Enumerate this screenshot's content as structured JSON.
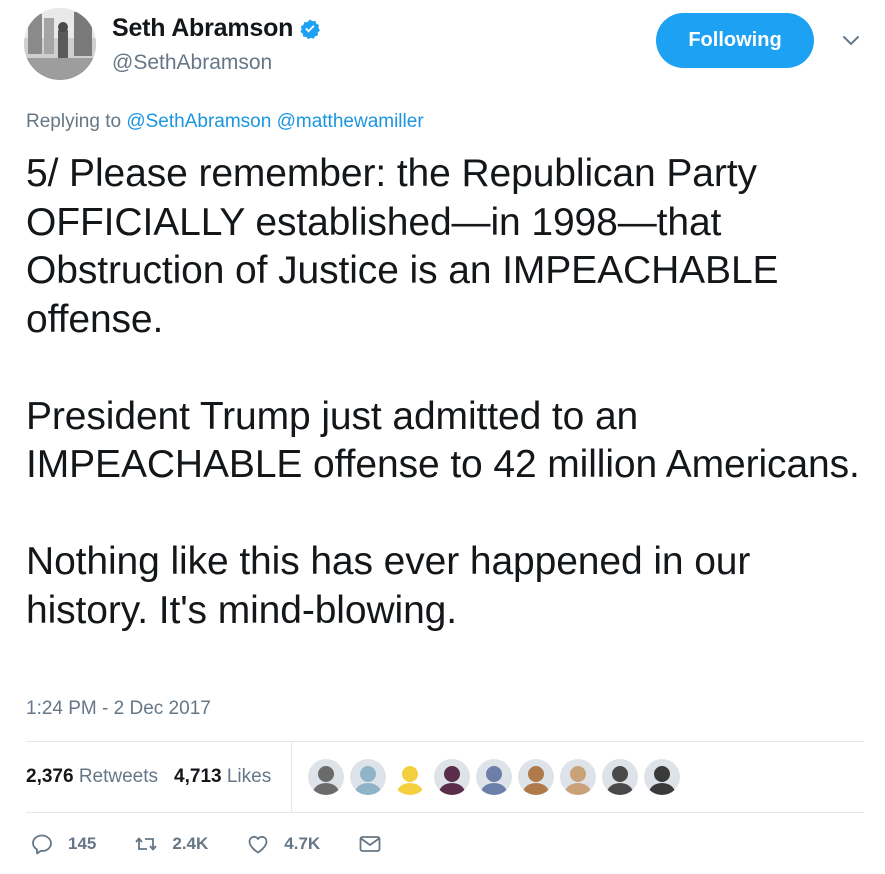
{
  "user": {
    "display_name": "Seth Abramson",
    "handle": "@SethAbramson",
    "verified": true,
    "avatar_icon": "profile-photo-street"
  },
  "follow_button": {
    "label": "Following",
    "color": "#1da1f2"
  },
  "menu": {
    "icon": "chevron-down-icon"
  },
  "reply": {
    "prefix": "Replying to",
    "mentions": [
      "@SethAbramson",
      "@matthewamiller"
    ]
  },
  "tweet": {
    "text": "5/ Please remember: the Republican Party OFFICIALLY established—in 1998—that Obstruction of Justice is an IMPEACHABLE offense.\n\nPresident Trump just admitted to an IMPEACHABLE offense to 42 million Americans.\n\nNothing like this has ever happened in our history. It's mind-blowing.",
    "timestamp": "1:24 PM - 2 Dec 2017"
  },
  "stats": {
    "retweets_count": "2,376",
    "retweets_label": "Retweets",
    "likes_count": "4,713",
    "likes_label": "Likes"
  },
  "likers": [
    {
      "icon": "liker-avatar-1",
      "color": "#6b6b6b"
    },
    {
      "icon": "liker-avatar-2",
      "color": "#8fb3c9"
    },
    {
      "icon": "liker-avatar-3",
      "color": "#f4d03f"
    },
    {
      "icon": "liker-avatar-4",
      "color": "#5a2d4a"
    },
    {
      "icon": "liker-avatar-5",
      "color": "#6c7fa8"
    },
    {
      "icon": "liker-avatar-6",
      "color": "#b07a4a"
    },
    {
      "icon": "liker-avatar-7",
      "color": "#c9a27a"
    },
    {
      "icon": "liker-avatar-8",
      "color": "#4a4a4a"
    },
    {
      "icon": "liker-avatar-9",
      "color": "#3a3a3a"
    }
  ],
  "actions": {
    "reply_count": "145",
    "retweet_count": "2.4K",
    "like_count": "4.7K"
  },
  "colors": {
    "link": "#1b95e0",
    "secondary_text": "#657786",
    "primary_text": "#14171a",
    "divider": "#e1e8ed"
  }
}
